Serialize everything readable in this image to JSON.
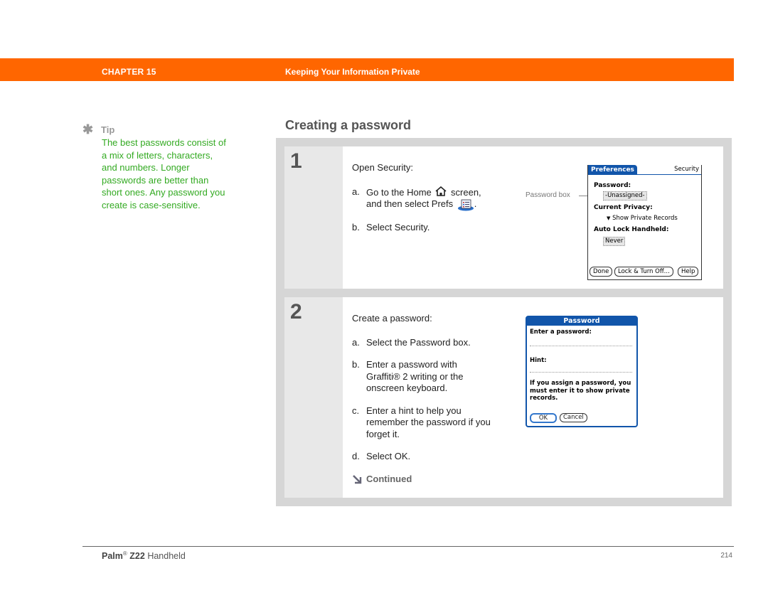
{
  "header": {
    "chapter": "CHAPTER 15",
    "title": "Keeping Your Information Private",
    "bar_color": "#ff6600"
  },
  "tip": {
    "icon": "asterisk-icon",
    "label": "Tip",
    "text": "The best passwords consist of a mix of letters, characters, and numbers. Longer passwords are better than short ones. Any password you create is case-sensitive.",
    "color": "#33aa22"
  },
  "section": {
    "title": "Creating a password"
  },
  "steps": [
    {
      "number": "1",
      "intro": "Open Security:",
      "items": [
        {
          "label": "a.",
          "text_before": "Go to the Home",
          "icon1": "home-icon",
          "text_middle": "screen, and then select Prefs",
          "icon2": "prefs-icon",
          "text_after": "."
        },
        {
          "label": "b.",
          "text": "Select Security."
        }
      ]
    },
    {
      "number": "2",
      "intro": "Create a password:",
      "items": [
        {
          "label": "a.",
          "text": "Select the Password box."
        },
        {
          "label": "b.",
          "text": "Enter a password with Graffiti® 2 writing or the onscreen keyboard."
        },
        {
          "label": "c.",
          "text": "Enter a hint to help you remember the password if you forget it."
        },
        {
          "label": "d.",
          "text": "Select OK."
        }
      ],
      "continued": "Continued"
    }
  ],
  "screen1": {
    "callout": "Password box",
    "tab": "Preferences",
    "category": "Security",
    "password_label": "Password:",
    "password_value": "-Unassigned-",
    "privacy_label": "Current Privacy:",
    "privacy_value": "Show Private Records",
    "autolock_label": "Auto Lock Handheld:",
    "autolock_value": "Never",
    "buttons": [
      "Done",
      "Lock & Turn Off...",
      "Help"
    ]
  },
  "screen2": {
    "title": "Password",
    "enter_label": "Enter a password:",
    "hint_label": "Hint:",
    "message": "If you assign a password, you must enter it to show private records.",
    "ok": "OK",
    "cancel": "Cancel"
  },
  "footer": {
    "brand": "Palm",
    "reg": "®",
    "model": "Z22",
    "product": "Handheld",
    "page": "214"
  }
}
